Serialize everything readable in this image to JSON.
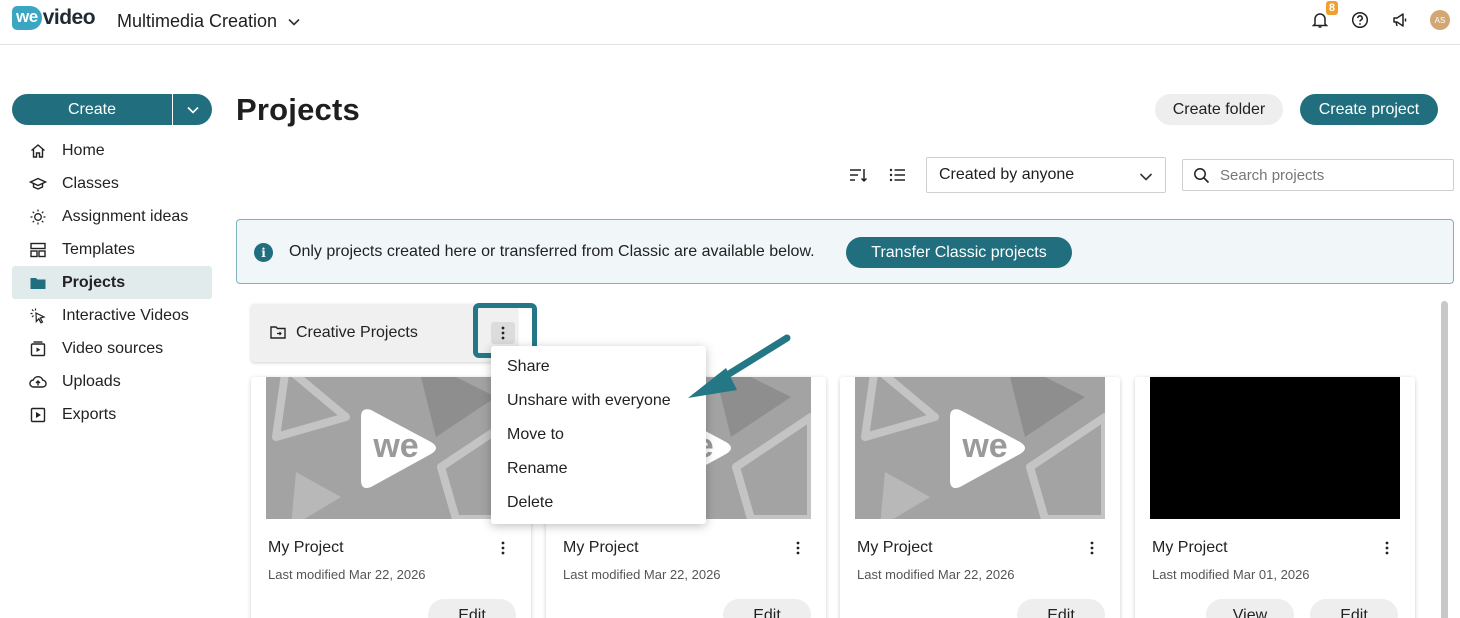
{
  "topbar": {
    "logo_we": "we",
    "logo_video": "video",
    "workspace": "Multimedia Creation",
    "notification_count": "8",
    "avatar_initials": "AS"
  },
  "sidebar": {
    "create_label": "Create",
    "items": [
      {
        "label": "Home",
        "icon": "home-icon"
      },
      {
        "label": "Classes",
        "icon": "classes-icon"
      },
      {
        "label": "Assignment ideas",
        "icon": "lightbulb-icon"
      },
      {
        "label": "Templates",
        "icon": "templates-icon"
      },
      {
        "label": "Projects",
        "icon": "folder-icon",
        "active": true
      },
      {
        "label": "Interactive Videos",
        "icon": "pointer-click-icon"
      },
      {
        "label": "Video sources",
        "icon": "video-sources-icon"
      },
      {
        "label": "Uploads",
        "icon": "cloud-upload-icon"
      },
      {
        "label": "Exports",
        "icon": "export-icon"
      }
    ]
  },
  "header": {
    "title": "Projects",
    "create_folder": "Create folder",
    "create_project": "Create project"
  },
  "toolbar": {
    "filter_value": "Created by anyone",
    "search_placeholder": "Search projects"
  },
  "banner": {
    "message": "Only projects created here or transferred from Classic are available below.",
    "button": "Transfer Classic projects"
  },
  "folder": {
    "name": "Creative Projects"
  },
  "context_menu": {
    "items": [
      "Share",
      "Unshare with everyone",
      "Move to",
      "Rename",
      "Delete"
    ]
  },
  "projects": [
    {
      "title": "My Project",
      "modified": "Last modified Mar 22, 2026",
      "buttons": [
        "Edit"
      ],
      "thumb": "logo"
    },
    {
      "title": "My Project",
      "modified": "Last modified Mar 22, 2026",
      "buttons": [
        "Edit"
      ],
      "thumb": "logo"
    },
    {
      "title": "My Project",
      "modified": "Last modified Mar 22, 2026",
      "buttons": [
        "Edit"
      ],
      "thumb": "logo"
    },
    {
      "title": "My Project",
      "modified": "Last modified Mar 01, 2026",
      "buttons": [
        "View",
        "Edit"
      ],
      "thumb": "black"
    }
  ],
  "colors": {
    "brand": "#216f7e",
    "logo_blue": "#3aa6c2",
    "badge": "#f0a030",
    "highlight": "#247886"
  }
}
